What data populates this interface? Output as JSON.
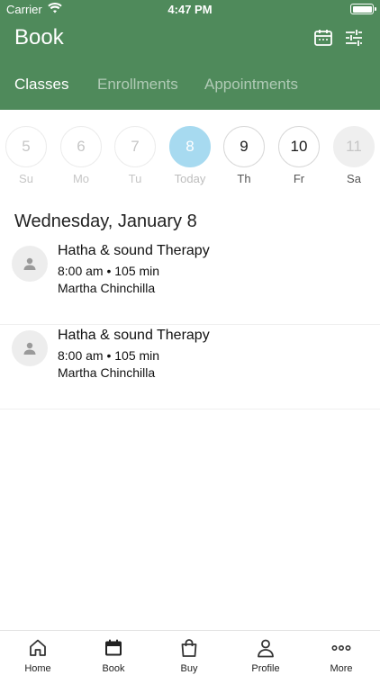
{
  "status_bar": {
    "carrier": "Carrier",
    "time": "4:47 PM"
  },
  "header": {
    "title": "Book",
    "icons": [
      "calendar-icon",
      "filter-sliders-icon"
    ],
    "background_color": "#4f8a5b"
  },
  "tabs": [
    {
      "label": "Classes",
      "active": true
    },
    {
      "label": "Enrollments",
      "active": false
    },
    {
      "label": "Appointments",
      "active": false
    }
  ],
  "week": [
    {
      "number": "5",
      "label": "Su",
      "state": "past"
    },
    {
      "number": "6",
      "label": "Mo",
      "state": "past"
    },
    {
      "number": "7",
      "label": "Tu",
      "state": "past"
    },
    {
      "number": "8",
      "label": "Today",
      "state": "today"
    },
    {
      "number": "9",
      "label": "Th",
      "state": "future"
    },
    {
      "number": "10",
      "label": "Fr",
      "state": "future"
    },
    {
      "number": "11",
      "label": "Sa",
      "state": "off"
    }
  ],
  "accent_color": "#a7daf0",
  "date_heading": "Wednesday, January 8",
  "classes": [
    {
      "title": "Hatha & sound Therapy",
      "meta": "8:00 am • 105 min",
      "teacher": "Martha Chinchilla"
    },
    {
      "title": "Hatha & sound Therapy",
      "meta": "8:00 am • 105 min",
      "teacher": "Martha Chinchilla"
    }
  ],
  "tabbar": [
    {
      "label": "Home",
      "icon": "home-icon"
    },
    {
      "label": "Book",
      "icon": "calendar-icon"
    },
    {
      "label": "Buy",
      "icon": "shopping-bag-icon"
    },
    {
      "label": "Profile",
      "icon": "person-icon"
    },
    {
      "label": "More",
      "icon": "more-dots-icon"
    }
  ]
}
